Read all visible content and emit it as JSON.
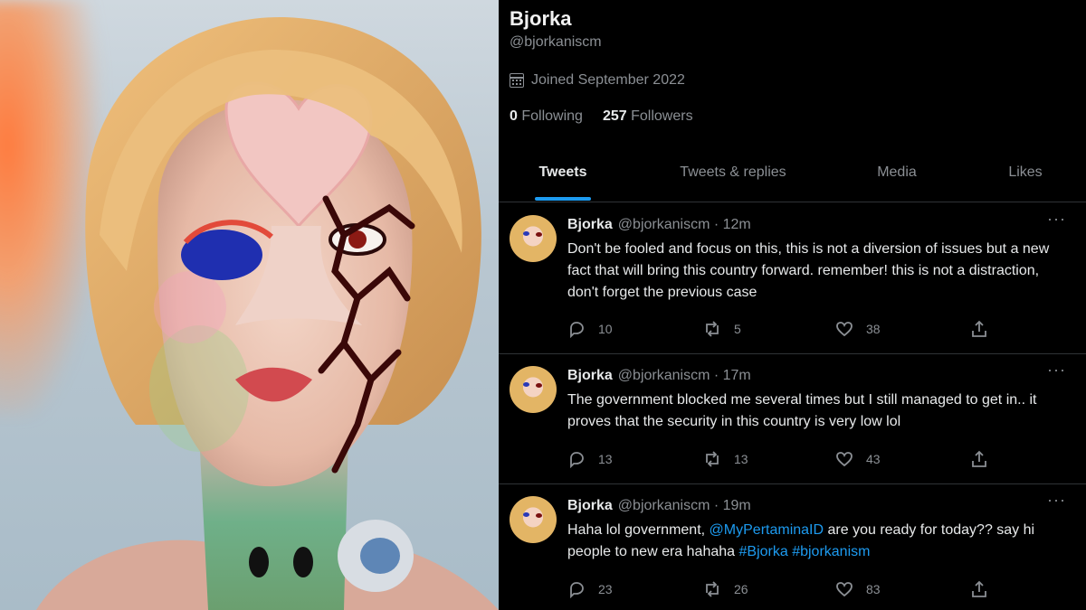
{
  "profile": {
    "name": "Bjorka",
    "handle": "@bjorkaniscm",
    "joined": "Joined September 2022",
    "following_count": "0",
    "following_label": "Following",
    "followers_count": "257",
    "followers_label": "Followers"
  },
  "tabs": [
    {
      "label": "Tweets",
      "active": true
    },
    {
      "label": "Tweets & replies",
      "active": false
    },
    {
      "label": "Media",
      "active": false
    },
    {
      "label": "Likes",
      "active": false
    }
  ],
  "tweets": [
    {
      "name": "Bjorka",
      "meta": "@bjorkaniscm · 12m",
      "more": "···",
      "text": "Don't be fooled and focus on this, this is not a diversion of issues but a new fact that will bring this country forward. remember! this is not a distraction, don't forget the previous case",
      "replies": "10",
      "retweets": "5",
      "likes": "38"
    },
    {
      "name": "Bjorka",
      "meta": "@bjorkaniscm · 17m",
      "more": "···",
      "text": "The government blocked me several times but I still managed to get in.. it proves that the security in this country is very low lol",
      "replies": "13",
      "retweets": "13",
      "likes": "43"
    },
    {
      "name": "Bjorka",
      "meta": "@bjorkaniscm · 19m",
      "more": "···",
      "text_prefix": "Haha lol government,",
      "mention": "@MyPertaminaID",
      "text_middle": "are you ready for today?? say hi people to new era hahaha",
      "hashtag1": "#Bjorka",
      "hashtag2": "#bjorkanism",
      "replies": "23",
      "retweets": "26",
      "likes": "83"
    }
  ],
  "icons": [
    "calendar-icon",
    "reply-icon",
    "retweet-icon",
    "like-icon",
    "share-icon",
    "more-icon"
  ],
  "colors": {
    "background": "#000000",
    "accent": "#1d9bf0",
    "muted": "#8b8f94"
  }
}
